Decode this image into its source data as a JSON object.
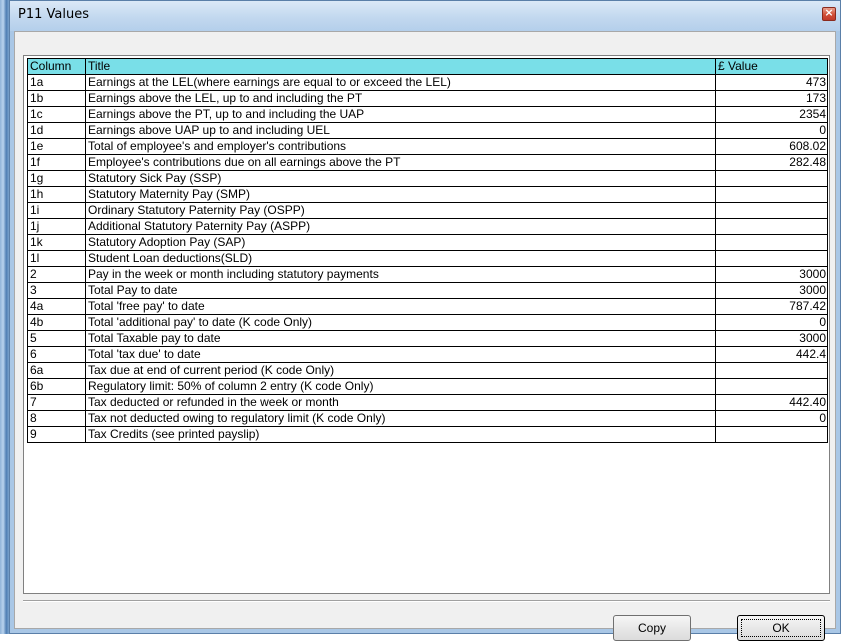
{
  "window": {
    "title": "P11 Values",
    "close_glyph": "×"
  },
  "table": {
    "headers": [
      "Column",
      "Title",
      "£ Value"
    ],
    "rows": [
      {
        "column": "1a",
        "title": "Earnings at the LEL(where earnings are equal to or exceed the LEL)",
        "value": "473"
      },
      {
        "column": "1b",
        "title": "Earnings above the LEL, up to and including the PT",
        "value": "173"
      },
      {
        "column": "1c",
        "title": "Earnings above the PT, up to and including the UAP",
        "value": "2354"
      },
      {
        "column": "1d",
        "title": "Earnings above UAP up to and including UEL",
        "value": "0"
      },
      {
        "column": "1e",
        "title": "Total of employee's and employer's contributions",
        "value": "608.02"
      },
      {
        "column": "1f",
        "title": "Employee's contributions due on all earnings above the PT",
        "value": "282.48"
      },
      {
        "column": "1g",
        "title": "Statutory Sick Pay (SSP)",
        "value": ""
      },
      {
        "column": "1h",
        "title": "Statutory Maternity Pay (SMP)",
        "value": ""
      },
      {
        "column": "1i",
        "title": "Ordinary Statutory Paternity Pay (OSPP)",
        "value": ""
      },
      {
        "column": "1j",
        "title": "Additional Statutory Paternity Pay (ASPP)",
        "value": ""
      },
      {
        "column": "1k",
        "title": "Statutory Adoption Pay (SAP)",
        "value": ""
      },
      {
        "column": "1l",
        "title": "Student Loan deductions(SLD)",
        "value": ""
      },
      {
        "column": "2",
        "title": "Pay in the week or month including statutory payments",
        "value": "3000"
      },
      {
        "column": "3",
        "title": "Total Pay to date",
        "value": "3000"
      },
      {
        "column": "4a",
        "title": "Total 'free pay' to date",
        "value": "787.42"
      },
      {
        "column": "4b",
        "title": "Total 'additional pay' to date (K code Only)",
        "value": "0"
      },
      {
        "column": "5",
        "title": "Total Taxable pay to date",
        "value": "3000"
      },
      {
        "column": "6",
        "title": "Total 'tax due' to date",
        "value": "442.4"
      },
      {
        "column": "6a",
        "title": "Tax due at end of current period (K code Only)",
        "value": ""
      },
      {
        "column": "6b",
        "title": "Regulatory limit: 50% of column 2 entry (K code Only)",
        "value": ""
      },
      {
        "column": "7",
        "title": "Tax deducted or refunded in the week or month",
        "value": "442.40"
      },
      {
        "column": "8",
        "title": "Tax not deducted owing to regulatory limit (K code Only)",
        "value": "0"
      },
      {
        "column": "9",
        "title": "Tax Credits (see printed payslip)",
        "value": ""
      }
    ]
  },
  "buttons": {
    "copy": "Copy",
    "ok": "OK"
  },
  "icons": {
    "close": "close-icon"
  }
}
